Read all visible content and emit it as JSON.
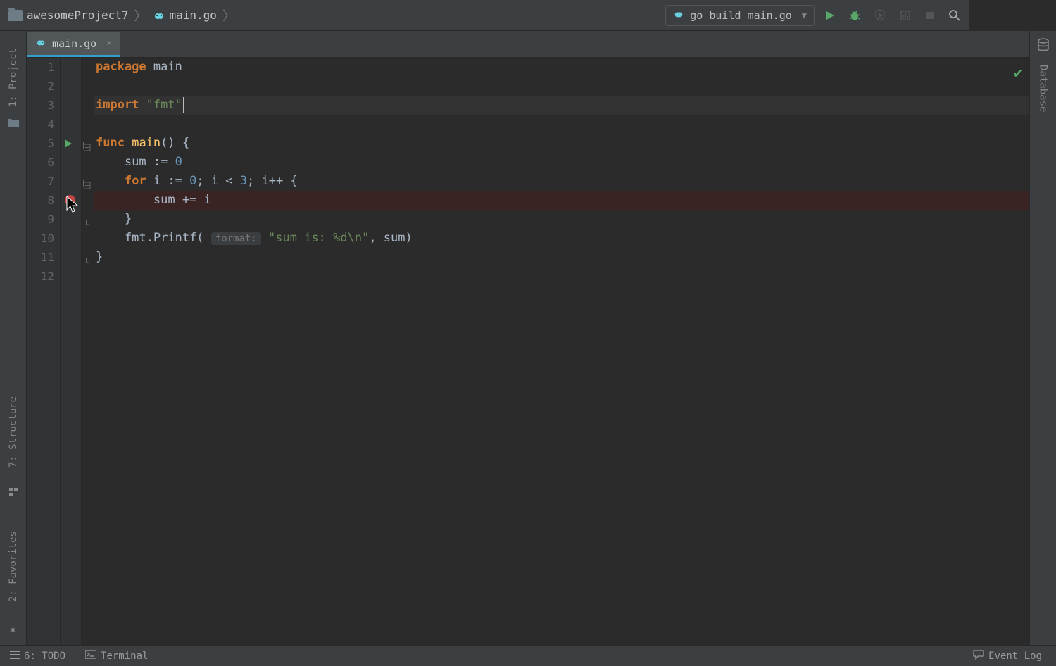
{
  "breadcrumb": {
    "project": "awesomeProject7",
    "file": "main.go"
  },
  "runConfig": {
    "label": "go build main.go"
  },
  "tab": {
    "name": "main.go"
  },
  "leftStrip": {
    "project": "1: Project",
    "structure": "7: Structure",
    "favorites": "2: Favorites"
  },
  "rightStrip": {
    "database": "Database"
  },
  "statusbar": {
    "todo_ul": "6",
    "todo_rest": ": TODO",
    "terminal": "Terminal",
    "eventLog": "Event Log"
  },
  "gutter": [
    "1",
    "2",
    "3",
    "4",
    "5",
    "6",
    "7",
    "8",
    "9",
    "10",
    "11",
    "12"
  ],
  "code": {
    "l1_kw": "package",
    "l1_id": "main",
    "l3_kw": "import",
    "l3_str": "\"fmt\"",
    "l5_kw": "func",
    "l5_fn": "main",
    "l5_rest": "() {",
    "l6": "    sum := ",
    "l6_num": "0",
    "l7_kw": "for",
    "l7_a": " i := ",
    "l7_n1": "0",
    "l7_b": "; i < ",
    "l7_n2": "3",
    "l7_c": "; i++ {",
    "l8": "        sum += i",
    "l9": "    }",
    "l10a": "    fmt.Printf( ",
    "l10_hint": "format:",
    "l10_str": "\"sum is: %d\\n\"",
    "l10b": ", sum)",
    "l11": "}"
  }
}
